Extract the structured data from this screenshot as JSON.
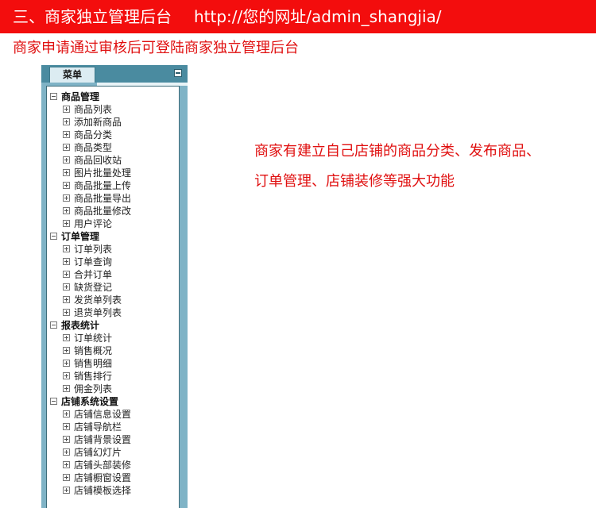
{
  "header": {
    "title": "三、商家独立管理后台",
    "url": "http://您的网址/admin_shangjia/"
  },
  "subtitle": "商家申请通过审核后可登陆商家独立管理后台",
  "menu": {
    "tab_label": "菜单",
    "groups": [
      {
        "label": "商品管理",
        "items": [
          "商品列表",
          "添加新商品",
          "商品分类",
          "商品类型",
          "商品回收站",
          "图片批量处理",
          "商品批量上传",
          "商品批量导出",
          "商品批量修改",
          "用户评论"
        ]
      },
      {
        "label": "订单管理",
        "items": [
          "订单列表",
          "订单查询",
          "合并订单",
          "缺货登记",
          "发货单列表",
          "退货单列表"
        ]
      },
      {
        "label": "报表统计",
        "items": [
          "订单统计",
          "销售概况",
          "销售明细",
          "销售排行",
          "佣金列表"
        ]
      },
      {
        "label": "店铺系统设置",
        "items": [
          "店铺信息设置",
          "店铺导航栏",
          "店铺背景设置",
          "店铺幻灯片",
          "店铺头部装修",
          "店铺橱窗设置",
          "店铺模板选择"
        ]
      }
    ]
  },
  "description": {
    "line1": "商家有建立自己店铺的商品分类、发布商品、",
    "line2": "订单管理、店铺装修等强大功能"
  },
  "colors": {
    "header_bg": "#f30d0d",
    "accent_text": "#e01010",
    "panel_bg": "#7fb3c6"
  }
}
